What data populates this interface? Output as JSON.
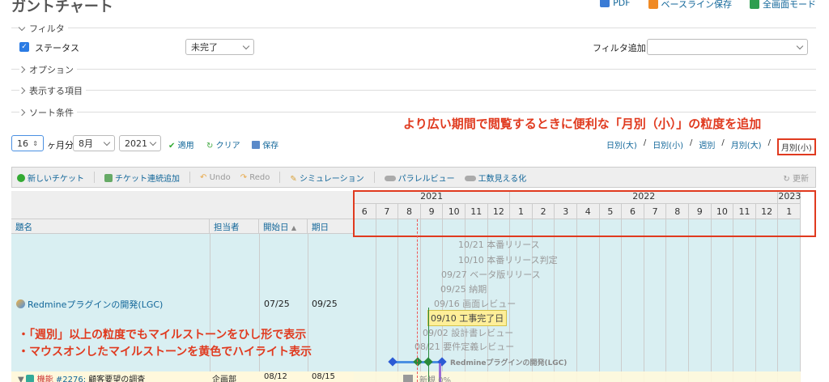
{
  "page": {
    "title": "ガントチャート"
  },
  "top_actions": [
    {
      "label": "PDF",
      "icon": "pdf-icon",
      "color": "#3a7bd5"
    },
    {
      "label": "ベースライン保存",
      "icon": "baseline-icon",
      "color": "#f08a24"
    },
    {
      "label": "全画面モード",
      "icon": "fullscreen-icon",
      "color": "#2e9e4f"
    }
  ],
  "filters": {
    "legend": "フィルタ",
    "status_label": "ステータス",
    "status_value": "未完了",
    "add_filter_label": "フィルタ追加",
    "add_filter_value": ""
  },
  "sections": {
    "options": "オプション",
    "display_items": "表示する項目",
    "sort": "ソート条件"
  },
  "period": {
    "months_value": "16",
    "months_suffix": "ヶ月分",
    "month_value": "8月",
    "year_value": "2021",
    "apply": "適用",
    "clear": "クリア",
    "save": "保存"
  },
  "zoom_links": [
    "日別(大)",
    "日別(小)",
    "週別",
    "月別(大)",
    "月別(小)"
  ],
  "zoom_separator": "/",
  "annotations": {
    "top_note": "より広い期間で閲覧するときに便利な「月別（小）」の粒度を追加",
    "bottom_note_1": "・「週別」以上の粒度でもマイルストーンをひし形で表示",
    "bottom_note_2": "・マウスオンしたマイルストーンを黄色でハイライト表示"
  },
  "toolbar": {
    "new_ticket": "新しいチケット",
    "bulk_add": "チケット連続追加",
    "undo": "Undo",
    "redo": "Redo",
    "simulation": "シミュレーション",
    "parallel_view": "パラレルビュー",
    "effort_view": "工数見える化",
    "refresh": "更新"
  },
  "columns": {
    "subject": "題名",
    "assignee": "担当者",
    "start_date": "開始日",
    "due_date": "期日"
  },
  "timeline": {
    "years": [
      "2021",
      "2022",
      "2023"
    ],
    "months": [
      "6",
      "7",
      "8",
      "9",
      "10",
      "11",
      "12",
      "1",
      "2",
      "3",
      "4",
      "5",
      "6",
      "7",
      "8",
      "9",
      "10",
      "11",
      "12",
      "1"
    ]
  },
  "rows": [
    {
      "subject": "Redmineプラグインの開発(LGC)",
      "assignee": "",
      "start": "07/25",
      "due": "09/25"
    },
    {
      "tracker": "機能",
      "id": "#2276:",
      "subject": "顧客要望の調査",
      "assignee": "企画部",
      "start": "08/12",
      "due": "08/15"
    }
  ],
  "milestones": [
    {
      "label": "10/21 本番リリース"
    },
    {
      "label": "10/10 本番リリース判定"
    },
    {
      "label": "09/27 ベータ版リリース"
    },
    {
      "label": "09/25 納期"
    },
    {
      "label": "09/16 画面レビュー"
    },
    {
      "label": "09/10 工事完了日",
      "highlight": true
    },
    {
      "label": "09/02 設計書レビュー"
    },
    {
      "label": "08/21 要件定義レビュー"
    }
  ],
  "bar_label": "Redmineプラグインの開発(LGC)",
  "child_bar_label": "新規 0%",
  "colors": {
    "accent_red": "#e03a1f",
    "link": "#116699",
    "row_bg": "#d9eff2",
    "highlight": "#ffef99"
  }
}
